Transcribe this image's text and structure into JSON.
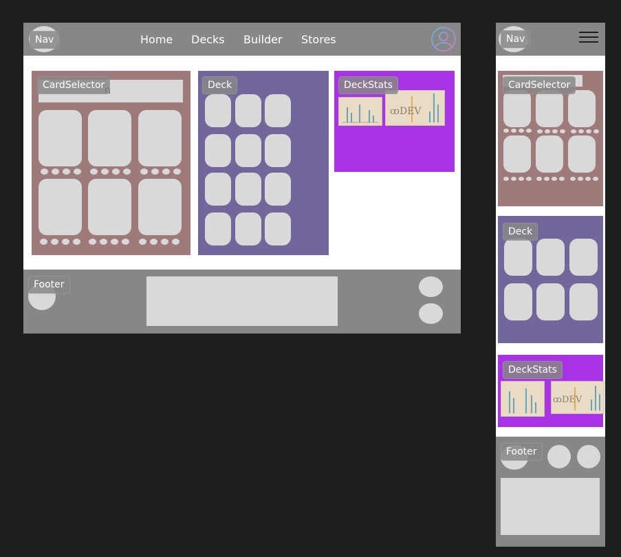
{
  "nav": {
    "label": "Nav",
    "links": [
      "Home",
      "Decks",
      "Builder",
      "Stores"
    ]
  },
  "sections": {
    "card_selector": "CardSelector",
    "deck": "Deck",
    "deck_stats": "DeckStats",
    "footer": "Footer"
  },
  "search": {
    "partial_text": "n"
  },
  "colors": {
    "canvas": "#1e1e1e",
    "nav": "#878787",
    "card_selector": "#9e7a7a",
    "deck": "#72669a",
    "deck_stats": "#a833e5",
    "placeholder": "#d9d9d9"
  },
  "icons": [
    "profile-icon",
    "hamburger-menu-icon"
  ]
}
